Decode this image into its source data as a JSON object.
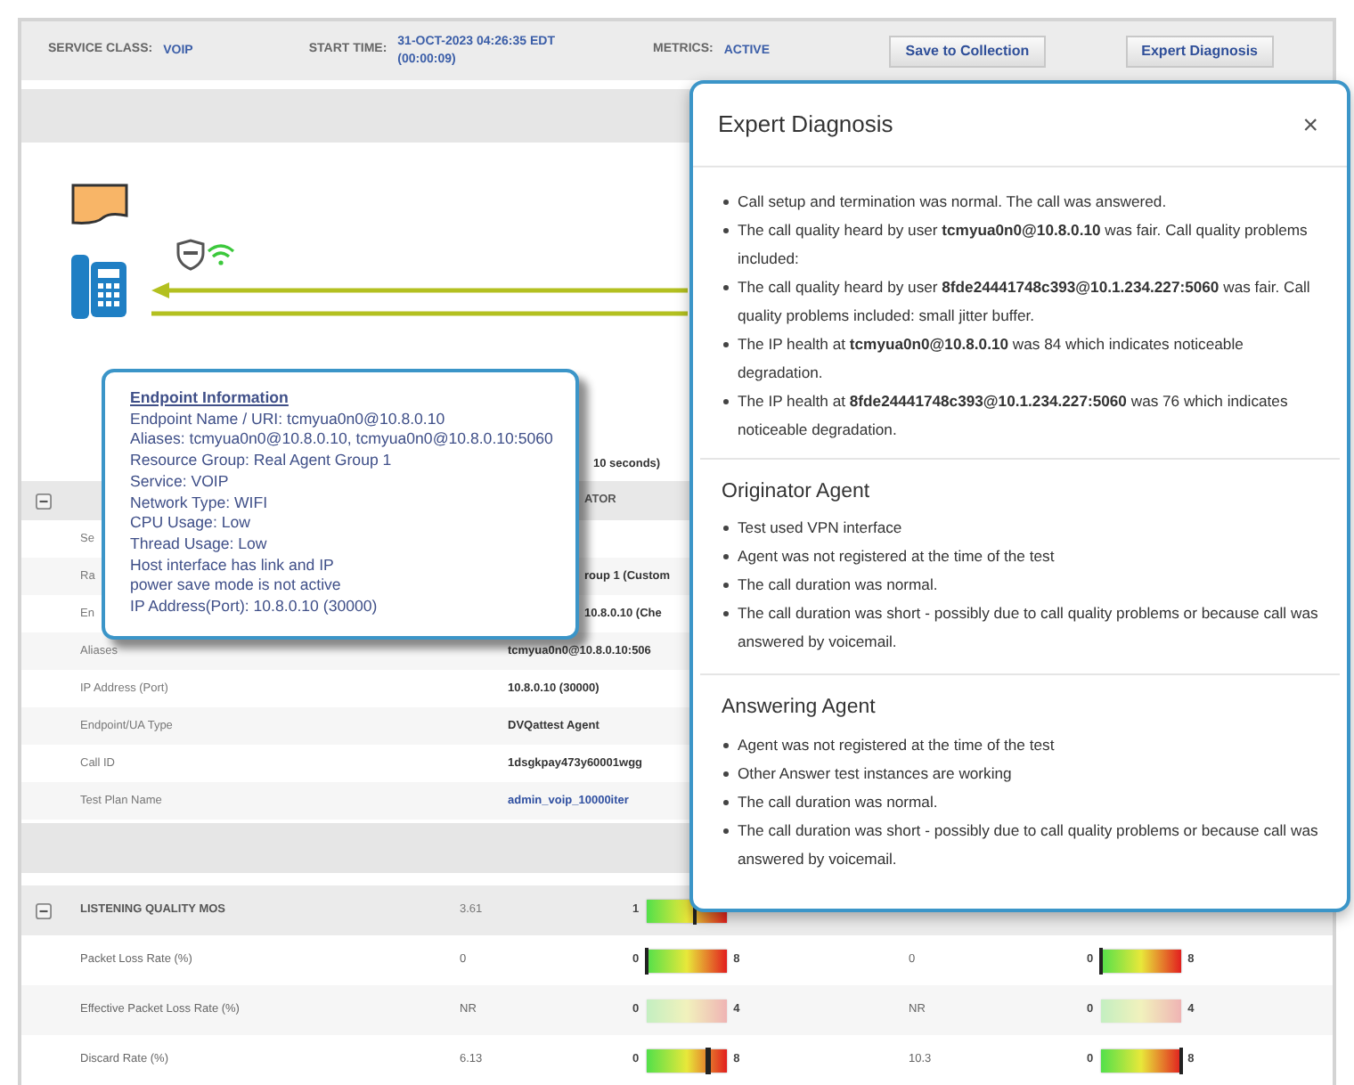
{
  "header": {
    "fields": [
      {
        "label": "SERVICE CLASS:",
        "value": "VOIP"
      },
      {
        "label": "START TIME:",
        "value": "31-OCT-2023 04:26:35 EDT",
        "sub": "(00:00:09)"
      },
      {
        "label": "METRICS:",
        "value": "ACTIVE"
      }
    ],
    "buttons": [
      "Save to Collection",
      "Expert Diagnosis"
    ]
  },
  "diagram": {
    "note": "10 seconds)"
  },
  "details": {
    "column_2": "ATOR",
    "rows": [
      {
        "label": "Se",
        "kind": "clipped"
      },
      {
        "label": "Ra",
        "value": "roup 1 (Custom",
        "kind": "clipped"
      },
      {
        "label": "En",
        "value": "10.8.0.10 (Che",
        "kind": "clipped"
      },
      {
        "label": "Aliases",
        "value": "tcmyua0n0@10.8.0.10:506",
        "kind": "plain"
      },
      {
        "label": "IP Address (Port)",
        "value": "10.8.0.10 (30000)",
        "kind": "plain"
      },
      {
        "label": "Endpoint/UA Type",
        "value": "DVQattest Agent",
        "kind": "plain"
      },
      {
        "label": "Call ID",
        "value": "1dsgkpay473y60001wgg",
        "kind": "plain"
      },
      {
        "label": "Test Plan Name",
        "value": "admin_voip_10000iter",
        "kind": "link"
      }
    ]
  },
  "tooltip": {
    "title": "Endpoint Information",
    "lines": [
      "Endpoint Name / URI: tcmyua0n0@10.8.0.10",
      "Aliases: tcmyua0n0@10.8.0.10, tcmyua0n0@10.8.0.10:5060",
      "Resource Group: Real Agent Group 1",
      "Service: VOIP",
      "Network Type: WIFI",
      "CPU Usage: Low",
      "Thread Usage: Low",
      "Host interface has link and IP",
      "power save mode is not active",
      "IP Address(Port): 10.8.0.10 (30000)"
    ]
  },
  "metrics": {
    "header": {
      "label": "LISTENING QUALITY MOS",
      "value": "3.61",
      "meter": {
        "min": "1",
        "level": 0.6,
        "faded": false
      }
    },
    "rows": [
      {
        "label": "Packet Loss Rate (%)",
        "value_1": "0",
        "meter_1": {
          "min": "0",
          "max": "8",
          "level": 0,
          "faded": false
        },
        "value_2": "0",
        "meter_2": {
          "min": "0",
          "max": "8",
          "level": 0,
          "faded": false
        }
      },
      {
        "label": "Effective Packet Loss Rate (%)",
        "value_1": "NR",
        "meter_1": {
          "min": "0",
          "max": "4",
          "faded": true
        },
        "value_2": "NR",
        "meter_2": {
          "min": "0",
          "max": "4",
          "faded": true
        }
      },
      {
        "label": "Discard Rate (%)",
        "value_1": "6.13",
        "meter_1": {
          "min": "0",
          "max": "8",
          "level": 0.77,
          "faded": false
        },
        "value_2": "10.3",
        "meter_2": {
          "min": "0",
          "max": "8",
          "level": 1,
          "faded": false
        }
      }
    ]
  },
  "modal": {
    "title": "Expert Diagnosis",
    "close": "×",
    "summary": [
      "Call setup and termination was normal. The call was answered.",
      "The call quality heard by user **tcmyua0n0@10.8.0.10** was fair. Call quality problems included:",
      "The call quality heard by user **8fde24441748c393@10.1.234.227:5060** was fair. Call quality problems included: small jitter buffer.",
      "The IP health at **tcmyua0n0@10.8.0.10** was 84 which indicates noticeable degradation.",
      "The IP health at **8fde24441748c393@10.1.234.227:5060** was 76 which indicates noticeable degradation."
    ],
    "sections": [
      {
        "title": "Originator Agent",
        "items": [
          "Test used VPN interface",
          "Agent was not registered at the time of the test",
          "The call duration was normal.",
          "The call duration was short - possibly due to call quality problems or because call was answered by voicemail."
        ]
      },
      {
        "title": "Answering Agent",
        "items": [
          "Agent was not registered at the time of the test",
          "Other Answer test instances are working",
          "The call duration was normal.",
          "The call duration was short - possibly due to call quality problems or because call was answered by voicemail."
        ]
      }
    ]
  }
}
